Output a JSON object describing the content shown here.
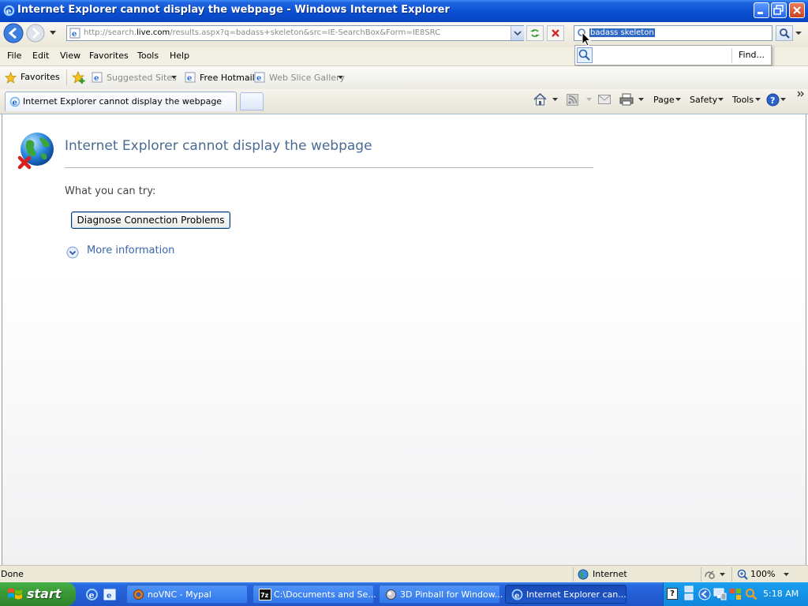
{
  "window": {
    "title": "Internet Explorer cannot display the webpage - Windows Internet Explorer"
  },
  "address": {
    "url_prefix": "http://search.",
    "url_domain": "live.com",
    "url_rest": "/results.aspx?q=badass+skeleton&src=IE-SearchBox&Form=IE8SRC"
  },
  "search": {
    "query": "badass skeleton",
    "find_label": "Find..."
  },
  "menu": {
    "items": [
      "File",
      "Edit",
      "View",
      "Favorites",
      "Tools",
      "Help"
    ]
  },
  "favorites_bar": {
    "favorites_label": "Favorites",
    "suggested_sites": "Suggested Sites",
    "free_hotmail": "Free Hotmail",
    "web_slice_gallery": "Web Slice Gallery"
  },
  "tabs": {
    "active_label": "Internet Explorer cannot display the webpage"
  },
  "command_bar": {
    "page": "Page",
    "safety": "Safety",
    "tools": "Tools"
  },
  "content": {
    "heading": "Internet Explorer cannot display the webpage",
    "try_label": "What you can try:",
    "diagnose_button": "Diagnose Connection Problems",
    "more_info": "More information"
  },
  "status": {
    "text": "Done",
    "zone": "Internet",
    "zoom": "100%"
  },
  "taskbar": {
    "start_label": "start",
    "tasks": [
      "noVNC - Mypal",
      "C:\\Documents and Se...",
      "3D Pinball for Window...",
      "Internet Explorer can..."
    ],
    "clock": "5:18 AM"
  }
}
